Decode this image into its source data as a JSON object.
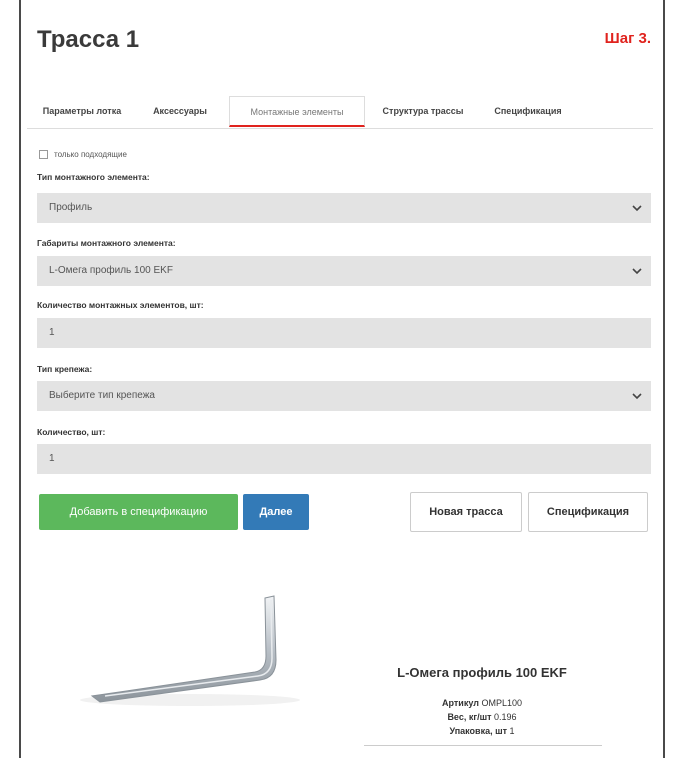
{
  "header": {
    "title": "Трасса 1",
    "step": "Шаг 3."
  },
  "tabs": [
    {
      "label": "Параметры лотка"
    },
    {
      "label": "Аксессуары"
    },
    {
      "label": "Монтажные элементы"
    },
    {
      "label": "Структура трассы"
    },
    {
      "label": "Спецификация"
    }
  ],
  "form": {
    "only_matching_label": "только подходящие",
    "mount_type_label": "Тип монтажного элемента:",
    "mount_type_value": "Профиль",
    "mount_size_label": "Габариты монтажного элемента:",
    "mount_size_value": "L-Омега профиль 100 EKF",
    "mount_count_label": "Количество монтажных элементов, шт:",
    "mount_count_value": "1",
    "fastener_type_label": "Тип крепежа:",
    "fastener_type_value": "Выберите тип крепежа",
    "qty_label": "Количество, шт:",
    "qty_value": "1"
  },
  "buttons": {
    "add_to_spec": "Добавить в спецификацию",
    "next": "Далее",
    "new_route": "Новая трасса",
    "specification": "Спецификация"
  },
  "product": {
    "name": "L-Омега профиль 100 EKF",
    "sku_label": "Артикул",
    "sku_value": "OMPL100",
    "weight_label": "Вес, кг/шт",
    "weight_value": "0.196",
    "pack_label": "Упаковка, шт",
    "pack_value": "1"
  },
  "colors": {
    "accent_red": "#e0231e",
    "button_green": "#5cb85c",
    "button_blue": "#337ab7",
    "field_bg": "#e3e3e3"
  }
}
